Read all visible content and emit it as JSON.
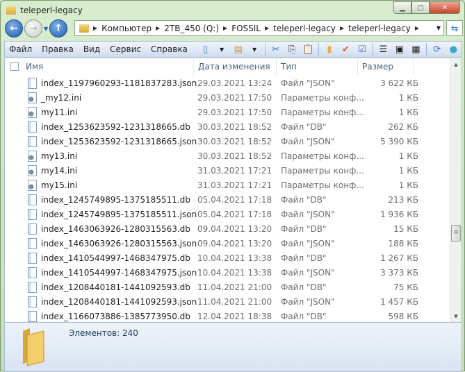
{
  "window": {
    "title": "teleperl-legacy"
  },
  "address": {
    "crumbs": [
      "Компьютер",
      "2TB_450 (Q:)",
      "FOSSIL",
      "teleperl-legacy",
      "teleperl-legacy"
    ]
  },
  "menu": [
    "Файл",
    "Правка",
    "Вид",
    "Сервис",
    "Справка"
  ],
  "columns": {
    "name": "Имя",
    "date": "Дата изменения",
    "type": "Тип",
    "size": "Размер"
  },
  "files": [
    {
      "name": "index_1197960293-1181837283.json",
      "date": "29.03.2021 13:24",
      "type": "Файл \"JSON\"",
      "size": "3 622 КБ",
      "kind": "file"
    },
    {
      "name": "_my12.ini",
      "date": "29.03.2021 17:50",
      "type": "Параметры конф...",
      "size": "1 КБ",
      "kind": "ini"
    },
    {
      "name": "my11.ini",
      "date": "29.03.2021 17:50",
      "type": "Параметры конф...",
      "size": "1 КБ",
      "kind": "ini"
    },
    {
      "name": "index_1253623592-1231318665.db",
      "date": "30.03.2021 18:52",
      "type": "Файл \"DB\"",
      "size": "262 КБ",
      "kind": "file"
    },
    {
      "name": "index_1253623592-1231318665.json",
      "date": "30.03.2021 18:52",
      "type": "Файл \"JSON\"",
      "size": "5 390 КБ",
      "kind": "file"
    },
    {
      "name": "my13.ini",
      "date": "30.03.2021 18:52",
      "type": "Параметры конф...",
      "size": "1 КБ",
      "kind": "ini"
    },
    {
      "name": "my14.ini",
      "date": "31.03.2021 17:21",
      "type": "Параметры конф...",
      "size": "1 КБ",
      "kind": "ini"
    },
    {
      "name": "my15.ini",
      "date": "31.03.2021 17:21",
      "type": "Параметры конф...",
      "size": "1 КБ",
      "kind": "ini"
    },
    {
      "name": "index_1245749895-1375185511.db",
      "date": "05.04.2021 17:18",
      "type": "Файл \"DB\"",
      "size": "213 КБ",
      "kind": "file"
    },
    {
      "name": "index_1245749895-1375185511.json",
      "date": "05.04.2021 17:18",
      "type": "Файл \"JSON\"",
      "size": "1 936 КБ",
      "kind": "file"
    },
    {
      "name": "index_1463063926-1280315563.db",
      "date": "09.04.2021 13:20",
      "type": "Файл \"DB\"",
      "size": "15 КБ",
      "kind": "file"
    },
    {
      "name": "index_1463063926-1280315563.json",
      "date": "09.04.2021 13:20",
      "type": "Файл \"JSON\"",
      "size": "188 КБ",
      "kind": "file"
    },
    {
      "name": "index_1410544997-1468347975.db",
      "date": "10.04.2021 13:38",
      "type": "Файл \"DB\"",
      "size": "1 267 КБ",
      "kind": "file"
    },
    {
      "name": "index_1410544997-1468347975.json",
      "date": "10.04.2021 13:38",
      "type": "Файл \"JSON\"",
      "size": "3 373 КБ",
      "kind": "file"
    },
    {
      "name": "index_1208440181-1441092593.db",
      "date": "11.04.2021 21:00",
      "type": "Файл \"DB\"",
      "size": "75 КБ",
      "kind": "file"
    },
    {
      "name": "index_1208440181-1441092593.json",
      "date": "11.04.2021 21:00",
      "type": "Файл \"JSON\"",
      "size": "1 457 КБ",
      "kind": "file"
    },
    {
      "name": "index_1166073886-1385773950.db",
      "date": "12.04.2021 18:38",
      "type": "Файл \"DB\"",
      "size": "598 КБ",
      "kind": "file"
    }
  ],
  "status": {
    "count": "Элементов: 240"
  }
}
